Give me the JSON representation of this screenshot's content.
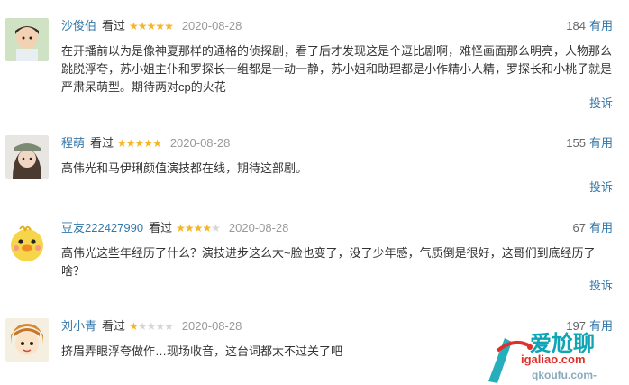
{
  "reviews": [
    {
      "user": "沙俊伯",
      "watched": "看过",
      "stars": 5,
      "date": "2020-08-28",
      "useful_count": "184",
      "useful_label": "有用",
      "content": "在开播前以为是像神夏那样的通格的侦探剧，看了后才发现这是个逗比剧啊，难怪画面那么明亮，人物那么跳脱浮夸，苏小姐主仆和罗探长一组都是一动一静，苏小姐和助理都是小作精小人精，罗探长和小桃子就是严肃呆萌型。期待两对cp的火花",
      "report": "投诉"
    },
    {
      "user": "程萌",
      "watched": "看过",
      "stars": 5,
      "date": "2020-08-28",
      "useful_count": "155",
      "useful_label": "有用",
      "content": "高伟光和马伊琍颜值演技都在线，期待这部剧。",
      "report": "投诉"
    },
    {
      "user": "豆友222427990",
      "watched": "看过",
      "stars": 4,
      "date": "2020-08-28",
      "useful_count": "67",
      "useful_label": "有用",
      "content": "高伟光这些年经历了什么？演技进步这么大~脸也变了，没了少年感，气质倒是很好，这哥们到底经历了啥？",
      "report": "投诉"
    },
    {
      "user": "刘小青",
      "watched": "看过",
      "stars": 1,
      "date": "2020-08-28",
      "useful_count": "197",
      "useful_label": "有用",
      "content": "挤眉弄眼浮夸做作…现场收音，这台词都太不过关了吧",
      "report": ""
    }
  ],
  "watermark": {
    "line1": "爱尬聊",
    "line2": "igaliao.com",
    "line3": "qkoufu.com-"
  },
  "colors": {
    "link": "#3377aa",
    "star_on": "#f7b524",
    "star_off": "#d6d6d6",
    "date": "#999999",
    "watermark_teal": "#0ea5b5",
    "watermark_red": "#e0302a"
  }
}
